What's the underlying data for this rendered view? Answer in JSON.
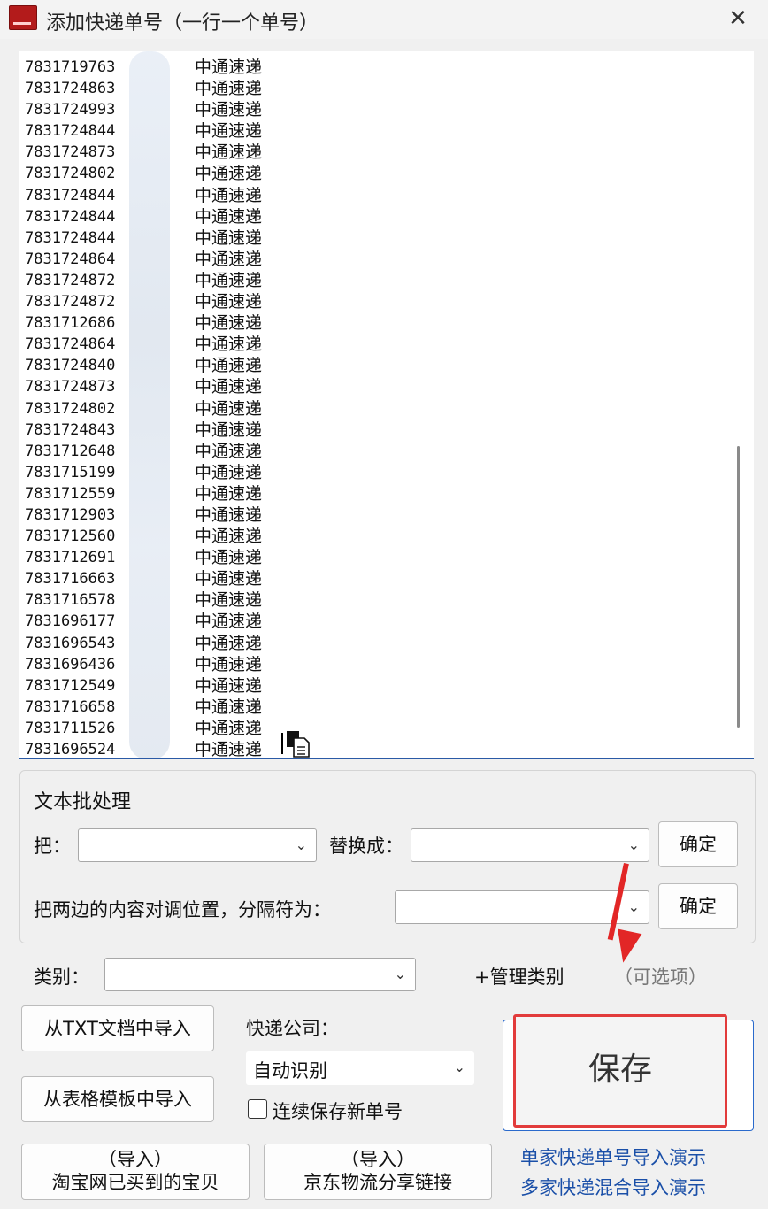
{
  "window": {
    "title": "添加快递单号（一行一个单号）",
    "close_label": "✕"
  },
  "entries": [
    {
      "num": "7831719763",
      "courier": "中通速递"
    },
    {
      "num": "7831724863",
      "courier": "中通速递"
    },
    {
      "num": "7831724993",
      "courier": "中通速递"
    },
    {
      "num": "7831724844",
      "courier": "中通速递"
    },
    {
      "num": "7831724873",
      "courier": "中通速递"
    },
    {
      "num": "7831724802",
      "courier": "中通速递"
    },
    {
      "num": "7831724844",
      "courier": "中通速递"
    },
    {
      "num": "7831724844",
      "courier": "中通速递"
    },
    {
      "num": "7831724844",
      "courier": "中通速递"
    },
    {
      "num": "7831724864",
      "courier": "中通速递"
    },
    {
      "num": "7831724872",
      "courier": "中通速递"
    },
    {
      "num": "7831724872",
      "courier": "中通速递"
    },
    {
      "num": "7831712686",
      "courier": "中通速递"
    },
    {
      "num": "7831724864",
      "courier": "中通速递"
    },
    {
      "num": "7831724840",
      "courier": "中通速递"
    },
    {
      "num": "7831724873",
      "courier": "中通速递"
    },
    {
      "num": "7831724802",
      "courier": "中通速递"
    },
    {
      "num": "7831724843",
      "courier": "中通速递"
    },
    {
      "num": "7831712648",
      "courier": "中通速递"
    },
    {
      "num": "7831715199",
      "courier": "中通速递"
    },
    {
      "num": "7831712559",
      "courier": "中通速递"
    },
    {
      "num": "7831712903",
      "courier": "中通速递"
    },
    {
      "num": "7831712560",
      "courier": "中通速递"
    },
    {
      "num": "7831712691",
      "courier": "中通速递"
    },
    {
      "num": "7831716663",
      "courier": "中通速递"
    },
    {
      "num": "7831716578",
      "courier": "中通速递"
    },
    {
      "num": "7831696177",
      "courier": "中通速递"
    },
    {
      "num": "7831696543",
      "courier": "中通速递"
    },
    {
      "num": "7831696436",
      "courier": "中通速递"
    },
    {
      "num": "7831712549",
      "courier": "中通速递"
    },
    {
      "num": "7831716658",
      "courier": "中通速递"
    },
    {
      "num": "7831711526",
      "courier": "中通速递"
    },
    {
      "num": "7831696524",
      "courier": "中通速递"
    }
  ],
  "batch": {
    "title": "文本批处理",
    "ba_label": "把：",
    "replace_label": "替换成：",
    "confirm1": "确定",
    "swap_label": "把两边的内容对调位置，分隔符为：",
    "confirm2": "确定"
  },
  "category": {
    "label": "类别：",
    "manage": "+管理类别",
    "optional": "（可选项）"
  },
  "courier_company": {
    "label": "快递公司：",
    "value": "自动识别"
  },
  "buttons": {
    "import_txt": "从TXT文档中导入",
    "import_table": "从表格模板中导入",
    "taobao_top": "（导入）",
    "taobao_bottom": "淘宝网已买到的宝贝",
    "jd_top": "（导入）",
    "jd_bottom": "京东物流分享链接",
    "save": "保存"
  },
  "continuous_save": {
    "label": "连续保存新单号",
    "checked": false
  },
  "demo_links": {
    "single": "单家快递单号导入演示",
    "multi": "多家快递混合导入演示"
  },
  "colors": {
    "accent": "#2a5aa6",
    "highlight": "#e23b3b",
    "link": "#1a4fa8"
  }
}
